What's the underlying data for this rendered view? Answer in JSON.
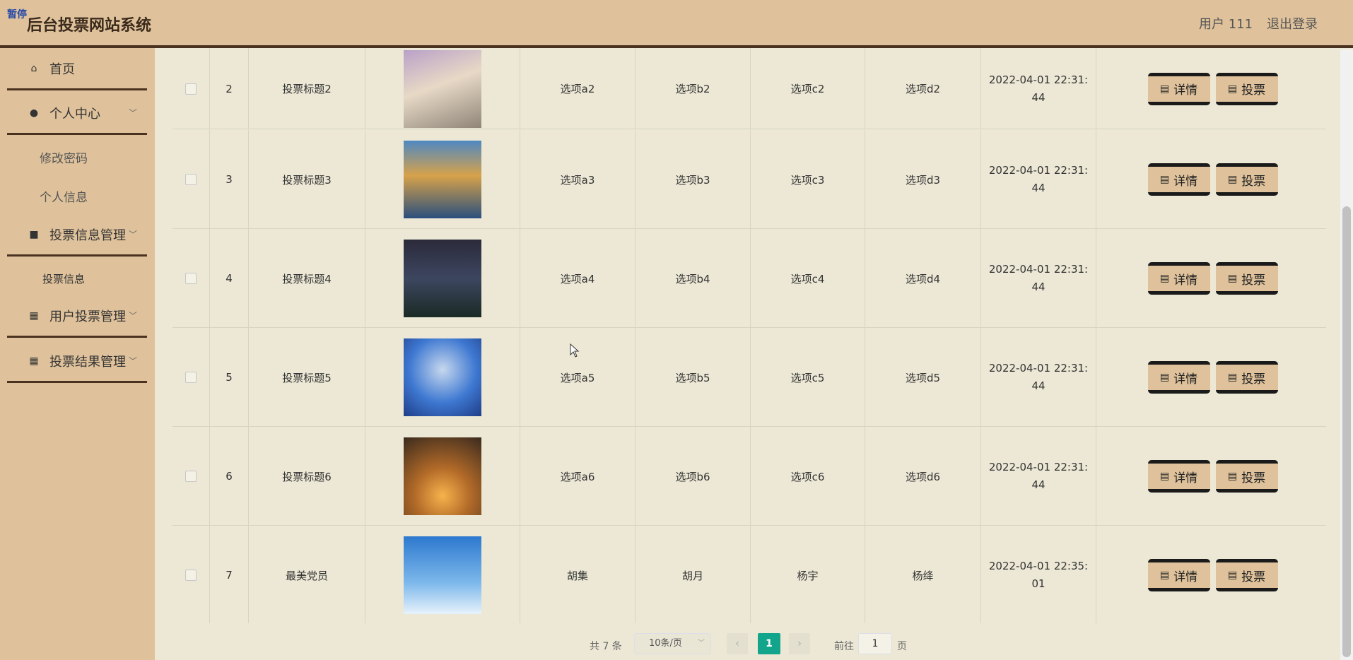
{
  "header": {
    "badge": "暂停",
    "title": "后台投票网站系统",
    "user": "用户 111",
    "logout": "退出登录"
  },
  "sidebar": {
    "home": "首页",
    "personal_center": "个人中心",
    "change_password": "修改密码",
    "personal_info": "个人信息",
    "vote_info_mgmt": "投票信息管理",
    "vote_info": "投票信息",
    "user_vote_mgmt": "用户投票管理",
    "vote_result_mgmt": "投票结果管理"
  },
  "table": {
    "detail_label": "详情",
    "vote_label": "投票",
    "rows": [
      {
        "index": "2",
        "title": "投票标题2",
        "a": "选项a2",
        "b": "选项b2",
        "c": "选项c2",
        "d": "选项d2",
        "time1": "2022-04-01 22:31:",
        "time2": "44"
      },
      {
        "index": "3",
        "title": "投票标题3",
        "a": "选项a3",
        "b": "选项b3",
        "c": "选项c3",
        "d": "选项d3",
        "time1": "2022-04-01 22:31:",
        "time2": "44"
      },
      {
        "index": "4",
        "title": "投票标题4",
        "a": "选项a4",
        "b": "选项b4",
        "c": "选项c4",
        "d": "选项d4",
        "time1": "2022-04-01 22:31:",
        "time2": "44"
      },
      {
        "index": "5",
        "title": "投票标题5",
        "a": "选项a5",
        "b": "选项b5",
        "c": "选项c5",
        "d": "选项d5",
        "time1": "2022-04-01 22:31:",
        "time2": "44"
      },
      {
        "index": "6",
        "title": "投票标题6",
        "a": "选项a6",
        "b": "选项b6",
        "c": "选项c6",
        "d": "选项d6",
        "time1": "2022-04-01 22:31:",
        "time2": "44"
      },
      {
        "index": "7",
        "title": "最美党员",
        "a": "胡集",
        "b": "胡月",
        "c": "杨宇",
        "d": "杨绛",
        "time1": "2022-04-01 22:35:",
        "time2": "01"
      }
    ]
  },
  "pagination": {
    "total": "共 7 条",
    "page_size": "10条/页",
    "current": "1",
    "goto_label": "前往",
    "goto_value": "1",
    "page_label": "页"
  }
}
